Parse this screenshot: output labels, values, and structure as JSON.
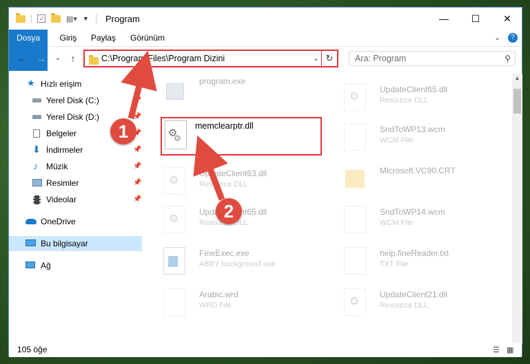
{
  "window": {
    "title": "Program",
    "controls": {
      "minimize": "—",
      "maximize": "☐",
      "close": "✕"
    }
  },
  "ribbon": {
    "tabs": [
      "Dosya",
      "Giriş",
      "Paylaş",
      "Görünüm"
    ],
    "expand_glyph": "⌄",
    "help_glyph": "?"
  },
  "address": {
    "path": "C:\\Program Files\\Program Dizini",
    "dropdown_glyph": "⌄",
    "refresh_glyph": "↻"
  },
  "search": {
    "placeholder": "Ara: Program",
    "icon": "search-icon"
  },
  "nav": {
    "back": "←",
    "forward": "→",
    "recent": "⌄",
    "up": "↑"
  },
  "sidebar": {
    "items": [
      {
        "label": "Hızlı erişim",
        "icon": "star-icon",
        "pinned": false
      },
      {
        "label": "Yerel Disk (C:)",
        "icon": "drive-icon",
        "pinned": true
      },
      {
        "label": "Yerel Disk (D:)",
        "icon": "drive-icon",
        "pinned": true
      },
      {
        "label": "Belgeler",
        "icon": "documents-icon",
        "pinned": true
      },
      {
        "label": "İndirmeler",
        "icon": "downloads-icon",
        "pinned": true
      },
      {
        "label": "Müzik",
        "icon": "music-icon",
        "pinned": true
      },
      {
        "label": "Resimler",
        "icon": "pictures-icon",
        "pinned": true
      },
      {
        "label": "Videolar",
        "icon": "videos-icon",
        "pinned": true
      },
      {
        "label": "OneDrive",
        "icon": "onedrive-icon",
        "pinned": false
      },
      {
        "label": "Bu bilgisayar",
        "icon": "computer-icon",
        "pinned": false,
        "selected": true
      },
      {
        "label": "Ağ",
        "icon": "network-icon",
        "pinned": false
      }
    ]
  },
  "files": {
    "highlighted": {
      "name": "memclearptr.dll"
    },
    "left": [
      {
        "name": "program.exe",
        "desc": ""
      },
      {
        "name": "UpdateClient63.dll",
        "desc": "Resource DLL"
      },
      {
        "name": "UpdateClient65.dll",
        "desc": "Resource DLL"
      },
      {
        "name": "FineExec.exe",
        "desc": "ABBY background exe"
      },
      {
        "name": "Arabic.wrd",
        "desc": "WRD File"
      }
    ],
    "right": [
      {
        "name": "UpdateClient65.dll",
        "desc": "Resource DLL"
      },
      {
        "name": "SndToWP13.wcm",
        "desc": "WCM File"
      },
      {
        "name": "Microsoft.VC90.CRT",
        "desc": ""
      },
      {
        "name": "SndToWP14.wcm",
        "desc": "WCM File"
      },
      {
        "name": "help.fineReader.txt",
        "desc": "TXT File"
      },
      {
        "name": "UpdateClient21.dll",
        "desc": "Resource DLL"
      }
    ]
  },
  "status": {
    "item_count": "105 öğe"
  },
  "callouts": [
    "1",
    "2"
  ],
  "colors": {
    "accent": "#1979ca",
    "highlight_red": "#e8313b",
    "badge_red": "#e04b3f",
    "selected_bg": "#cce8ff"
  }
}
